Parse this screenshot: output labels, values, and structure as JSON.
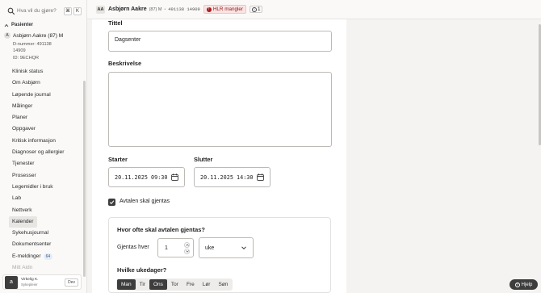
{
  "search": {
    "placeholder": "Hva vil du gjøre?",
    "kbd_cmd": "⌘",
    "kbd_key": "K"
  },
  "sidebar": {
    "section_title": "Pasienter",
    "patient": {
      "initial": "A",
      "name": "Asbjørn Aakre (87) M",
      "dnr_line1": "D-nummer: 491138",
      "dnr_line2": "14909",
      "id": "ID: 9ECHQR"
    },
    "items": [
      {
        "label": "Klinisk status"
      },
      {
        "label": "Om Asbjørn"
      },
      {
        "label": "Løpende journal"
      },
      {
        "label": "Målinger"
      },
      {
        "label": "Planer"
      },
      {
        "label": "Oppgaver"
      },
      {
        "label": "Kritisk informasjon"
      },
      {
        "label": "Diagnoser og allergier"
      },
      {
        "label": "Tjenester"
      },
      {
        "label": "Prosesser"
      },
      {
        "label": "Legemidler i bruk"
      },
      {
        "label": "Lab"
      },
      {
        "label": "Nettverk"
      },
      {
        "label": "Kalender"
      },
      {
        "label": "Sykehusjournal"
      },
      {
        "label": "Dokumentsenter"
      },
      {
        "label": "E-meldinger",
        "badge": "64"
      },
      {
        "label": "Mitt Aidn"
      }
    ],
    "user": {
      "avatar": "a",
      "name": "Virkelig K.",
      "role": "Sykepleier",
      "dev_label": "Dev"
    }
  },
  "topbar": {
    "initials": "AA",
    "name": "Asbjørn Aakre",
    "age": "(87) M",
    "dot": "•",
    "dnr": "491138 14909",
    "warning": "HLR mangler",
    "warning_icon": "!",
    "count": "1",
    "count_icon": "i"
  },
  "form": {
    "title_label": "Tittel",
    "title_value": "Dagsenter",
    "description_label": "Beskrivelse",
    "start_label": "Starter",
    "start_value": "20.11.2025 09:30",
    "end_label": "Slutter",
    "end_value": "20.11.2025 14:30",
    "repeat_label": "Avtalen skal gjentas",
    "repeat_checked": true,
    "recurrence": {
      "heading": "Hvor ofte skal avtalen gjentas?",
      "repeat_every_label": "Gjentas hver",
      "interval": "1",
      "unit": "uke",
      "weekdays_heading": "Hvilke ukedager?",
      "days": [
        {
          "label": "Man",
          "selected": true
        },
        {
          "label": "Tir",
          "selected": false
        },
        {
          "label": "Ons",
          "selected": true
        },
        {
          "label": "Tor",
          "selected": false
        },
        {
          "label": "Fre",
          "selected": false
        },
        {
          "label": "Lør",
          "selected": false
        },
        {
          "label": "Søn",
          "selected": false
        }
      ]
    }
  },
  "help": {
    "label": "Hjelp",
    "icon": "?"
  },
  "colors": {
    "dark": "#3d3d3d",
    "warning_bg": "#fbe3e3",
    "warning_text": "#8a1d1d",
    "badge_bg": "#e4edf7"
  }
}
